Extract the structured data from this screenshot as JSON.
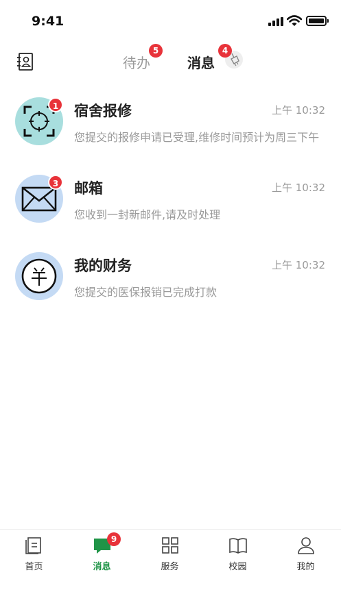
{
  "status_bar": {
    "time": "9:41"
  },
  "header": {
    "tabs": [
      {
        "label": "待办",
        "badge": "5",
        "active": false
      },
      {
        "label": "消息",
        "badge": "4",
        "active": true
      }
    ],
    "icons": {
      "contacts": "contacts-book-icon",
      "sweep": "clear-unread-broom-icon"
    }
  },
  "messages": [
    {
      "title": "宿舍报修",
      "time": "上午 10:32",
      "preview": "您提交的报修申请已受理,维修时间预计为周三下午",
      "badge": "1",
      "icon": "repair-scan-icon",
      "avatar_color": "#a8dede"
    },
    {
      "title": "邮箱",
      "time": "上午 10:32",
      "preview": "您收到一封新邮件,请及时处理",
      "badge": "3",
      "icon": "mail-envelope-icon",
      "avatar_color": "#c4daf4"
    },
    {
      "title": "我的财务",
      "time": "上午 10:32",
      "preview": "您提交的医保报销已完成打款",
      "badge": "",
      "icon": "yuan-currency-icon",
      "avatar_color": "#c4daf4"
    }
  ],
  "tabbar": {
    "items": [
      {
        "label": "首页",
        "icon": "home-document-icon",
        "active": false
      },
      {
        "label": "消息",
        "icon": "chat-bubble-icon",
        "active": true,
        "badge": "9"
      },
      {
        "label": "服务",
        "icon": "grid-apps-icon",
        "active": false
      },
      {
        "label": "校园",
        "icon": "open-book-icon",
        "active": false
      },
      {
        "label": "我的",
        "icon": "user-profile-icon",
        "active": false
      }
    ]
  },
  "colors": {
    "accent": "#1f9447",
    "badge": "#e8333a",
    "muted_text": "#9a9a9a"
  }
}
